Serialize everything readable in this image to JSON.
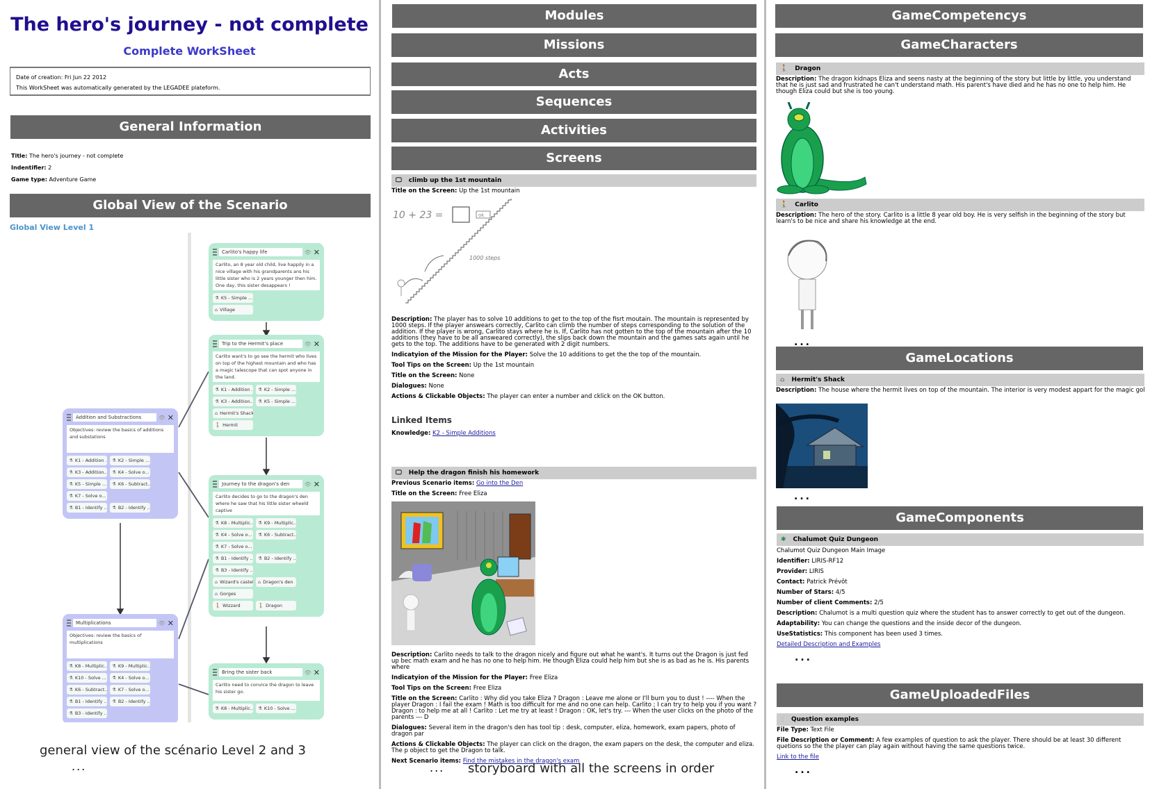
{
  "left": {
    "title": "The hero's journey - not complete",
    "subtitle": "Complete WorkSheet",
    "info": [
      "Date of creation: Fri Jun 22 2012",
      "This WorkSheet was automatically generated by the LEGADEE plateform."
    ],
    "general_bar": "General Information",
    "general_fields": [
      {
        "label": "Title:",
        "value": "The hero's journey - not complete"
      },
      {
        "label": "Indentifier:",
        "value": "2"
      },
      {
        "label": "Game type:",
        "value": "Adventure Game"
      }
    ],
    "global_bar": "Global View of the Scenario",
    "level1": "Global View Level 1",
    "caption": "general view of the scénario Level 2 and 3",
    "dots": "..."
  },
  "diagram": {
    "cards": [
      {
        "id": "a",
        "color": "green",
        "title": "Carlito's happy life",
        "desc": "Carlito, an 8 year old child, live happily in a nice village with his grandparents ans his little sister who is 2 years younger then him. One day, this sister desappears !",
        "rows": [
          [
            {
              "t": "k",
              "l": "K5 - Simple ..."
            }
          ],
          [
            {
              "t": "loc",
              "l": "Village"
            }
          ]
        ]
      },
      {
        "id": "b",
        "color": "green",
        "title": "Trip to the Hermit's place",
        "desc": "Carlito want's to go see the hermit who lives on top of the highest mountain and who has a magic talescope that can spot anyone in the land.",
        "rows": [
          [
            {
              "t": "k",
              "l": "K1 - Addition ..."
            },
            {
              "t": "k",
              "l": "K2 - Simple ..."
            }
          ],
          [
            {
              "t": "k",
              "l": "K3 - Addition..."
            },
            {
              "t": "k",
              "l": "K5 - Simple ..."
            }
          ],
          [
            {
              "t": "loc",
              "l": "Hermit's Shack"
            }
          ],
          [
            {
              "t": "ch",
              "l": "Hermit"
            }
          ]
        ]
      },
      {
        "id": "c",
        "color": "green",
        "title": "Journey to the dragon's den",
        "desc": "Carlito decides to go to the dragon's den where he saw that his little sister wheeld captive",
        "rows": [
          [
            {
              "t": "k",
              "l": "K8 - Multiplic..."
            },
            {
              "t": "k",
              "l": "K9 - Multiplic..."
            }
          ],
          [
            {
              "t": "k",
              "l": "K4 - Solve o..."
            },
            {
              "t": "k",
              "l": "K6 - Subtract..."
            }
          ],
          [
            {
              "t": "k",
              "l": "K7 - Solve o..."
            }
          ],
          [
            {
              "t": "k",
              "l": "B1 - Identify ..."
            },
            {
              "t": "k",
              "l": "B2 - Identify ..."
            }
          ],
          [
            {
              "t": "k",
              "l": "B3 - Identify ..."
            }
          ],
          [
            {
              "t": "loc",
              "l": "Wizard's castel"
            },
            {
              "t": "loc",
              "l": "Dragon's den"
            }
          ],
          [
            {
              "t": "loc",
              "l": "Gorges"
            }
          ],
          [
            {
              "t": "ch",
              "l": "Wizzard"
            },
            {
              "t": "ch",
              "l": "Dragon"
            }
          ]
        ]
      },
      {
        "id": "d",
        "color": "green",
        "title": "Bring the sister back",
        "desc": "Carlito need to convice the dragon to leave his sister go.",
        "rows": [
          [
            {
              "t": "k",
              "l": "K8 - Multiplic..."
            },
            {
              "t": "k",
              "l": "K10 - Solve ..."
            }
          ]
        ]
      },
      {
        "id": "l1",
        "color": "purple",
        "title": "Addition and Substractions",
        "desc": "Objectives: review the basics of additions and substations",
        "rows": [
          [
            {
              "t": "k",
              "l": "K1 - Addition ..."
            },
            {
              "t": "k",
              "l": "K2 - Simple ..."
            }
          ],
          [
            {
              "t": "k",
              "l": "K3 - Addition..."
            },
            {
              "t": "k",
              "l": "K4 - Solve o..."
            }
          ],
          [
            {
              "t": "k",
              "l": "K5 - Simple ..."
            },
            {
              "t": "k",
              "l": "K6 - Subtract..."
            }
          ],
          [
            {
              "t": "k",
              "l": "K7 - Solve o..."
            }
          ],
          [
            {
              "t": "k",
              "l": "B1 - Identify ..."
            },
            {
              "t": "k",
              "l": "B2 - Identify ..."
            }
          ]
        ]
      },
      {
        "id": "l2",
        "color": "purple",
        "title": "Multiplications",
        "desc": "Objectives: review the basics of multiplications",
        "rows": [
          [
            {
              "t": "k",
              "l": "K8 - Multiplic..."
            },
            {
              "t": "k",
              "l": "K9 - Multiplic..."
            }
          ],
          [
            {
              "t": "k",
              "l": "K10 - Solve ..."
            },
            {
              "t": "k",
              "l": "K4 - Solve o..."
            }
          ],
          [
            {
              "t": "k",
              "l": "K6 - Subtract..."
            },
            {
              "t": "k",
              "l": "K7 - Solve o..."
            }
          ],
          [
            {
              "t": "k",
              "l": "B1 - Identify ..."
            },
            {
              "t": "k",
              "l": "B2 - Identify ..."
            }
          ],
          [
            {
              "t": "k",
              "l": "B3 - Identify ..."
            }
          ]
        ]
      }
    ]
  },
  "middle": {
    "bars": [
      "Modules",
      "Missions",
      "Acts",
      "Sequences",
      "Activities",
      "Screens"
    ],
    "screen1": {
      "name": "climb up the 1st mountain",
      "title_field": {
        "label": "Title on the Screen:",
        "value": "Up the 1st mountain"
      },
      "sketch_text": {
        "equation": "10 + 23 =",
        "ok": "ok",
        "steps": "1000 steps"
      },
      "fields": [
        {
          "label": "Description:",
          "value": "The player has to solve 10 additions to get to the top of the fisrt moutain. The mountain is represented by 1000 steps. If the player answears correctly, Carlito can climb the number of steps corresponding to the solution of the addition. If the player is wrong, Carlito stays where he is. If, Carlito has not gotten to the top of the mountain after the 10 additions (they have to be all answeared correctly), the slips back down the mountain and the games sats again until he gets to the top. The additions have to be generated with 2 digit numbers."
        },
        {
          "label": "Indicatyion of the Mission for the Player:",
          "value": "Solve the 10 additions to get the the top of the mountain."
        },
        {
          "label": "Tool Tips on the Screen:",
          "value": "Up the 1st mountain"
        },
        {
          "label": "Title on the Screen:",
          "value": "None"
        },
        {
          "label": "Dialogues:",
          "value": "None"
        },
        {
          "label": "Actions & Clickable Objects:",
          "value": "The player can enter a number and cklick on the OK button."
        }
      ],
      "linked_heading": "Linked Items",
      "linked": {
        "label": "Knowledge:",
        "link": "K2 - Simple Additions"
      }
    },
    "screen2": {
      "name": "Help the dragon finish his homework",
      "prev": {
        "label": "Previous Scenario items:",
        "link": "Go into the Den"
      },
      "title_field": {
        "label": "Title on the Screen:",
        "value": "Free Eliza"
      },
      "fields": [
        {
          "label": "Description:",
          "value": "Carlito needs to talk to the dragon nicely and figure out what he want's. It turns out the Dragon is just fed up bec math exam and he has no one to help him. He though Eliza could help him but she is as bad as he is. His parents where"
        },
        {
          "label": "Indicatyion of the Mission for the Player:",
          "value": "Free Eliza"
        },
        {
          "label": "Tool Tips on the Screen:",
          "value": "Free Eliza"
        },
        {
          "label": "Title on the Screen:",
          "value": "Carlito : Why did you take Eliza ? Dragon : Leave me alone or I'll burn you to dust ! ---- When the player Dragon : I fail the exam ! Math is too difficult for me and no one can help. Carlito ; I can try to help you if you want ? Dragon : to help me at all ! Carlito : Let me try at least ! Dragon : OK, let's try. --- When the user clicks on the photo of the parents --- D"
        },
        {
          "label": "Dialogues:",
          "value": "Several item in the dragon's den has tool tip : desk, computer, eliza, homework, exam papers, photo of dragon par"
        },
        {
          "label": "Actions & Clickable Objects:",
          "value": "The player can click on the dragon, the exam papers on the desk, the computer and eliza. The p object to get the Dragon to talk."
        }
      ],
      "next": {
        "label": "Next Scenario items:",
        "link": "Find the mistakes in the dragon's exam"
      }
    },
    "caption_dots": "...",
    "caption": "storyboard with all the screens in order"
  },
  "right": {
    "bars": {
      "competencies": "GameCompetencys",
      "characters": "GameCharacters",
      "locations": "GameLocations",
      "components": "GameComponents",
      "files": "GameUploadedFiles"
    },
    "characters": [
      {
        "name": "Dragon",
        "desc_label": "Description:",
        "desc": "The dragon kidnaps Eliza and seens nasty at the beginning of the story but little by little, you understand that he is just sad and frustrated he can't understand math. His parent's have died and he has no one to help him. He though Eliza could but she is too young."
      },
      {
        "name": "Carlito",
        "desc_label": "Description:",
        "desc": "The hero of the story. Carlito is a little 8 year old boy. He is very selfish in the beginning of the story but learn's to be nice and share his knowledge at the end."
      }
    ],
    "location": {
      "name": "Hermit's Shack",
      "desc_label": "Description:",
      "desc": "The house where the hermit lives on top of the mountain. The interior is very modest appart for the magic gold telescope that can spot anyone in the land."
    },
    "component": {
      "name": "Chalumot Quiz Dungeon",
      "image_caption": "Chalumot Quiz Dungeon Main Image",
      "fields": [
        {
          "label": "Identifier:",
          "value": "LIRIS-RF12"
        },
        {
          "label": "Provider:",
          "value": "LIRIS"
        },
        {
          "label": "Contact:",
          "value": "Patrick Prévôt"
        },
        {
          "label": "Number of Stars:",
          "value": "4/5"
        },
        {
          "label": "Number of client Comments:",
          "value": "2/5"
        },
        {
          "label": "Description:",
          "value": "Chalumot is a multi question quiz where the student has to answer correctly to get out of the dungeon."
        },
        {
          "label": "Adaptability:",
          "value": "You can change the questions and the inside decor of the dungeon."
        },
        {
          "label": "UseStatistics:",
          "value": "This component has been used 3 times."
        }
      ],
      "link": "Detailed Description and Examples"
    },
    "file": {
      "name": "Question examples",
      "fields": [
        {
          "label": "File Type:",
          "value": "Text File"
        },
        {
          "label": "File Description or Comment:",
          "value": "A few examples of question to ask the player. There should be at least 30 different quetions so the the player can play again without having the same questions twice."
        }
      ],
      "link": "Link to the file"
    },
    "dots": "..."
  },
  "colors": {
    "title": "#1f0f8f",
    "subtitle": "#3a3ac8",
    "bar": "#666666",
    "level": "#4b93c9",
    "card_green": "#b9ead4",
    "card_purple": "#c3c6f5",
    "link": "#1a1a9a",
    "item_header": "#cccccc"
  }
}
